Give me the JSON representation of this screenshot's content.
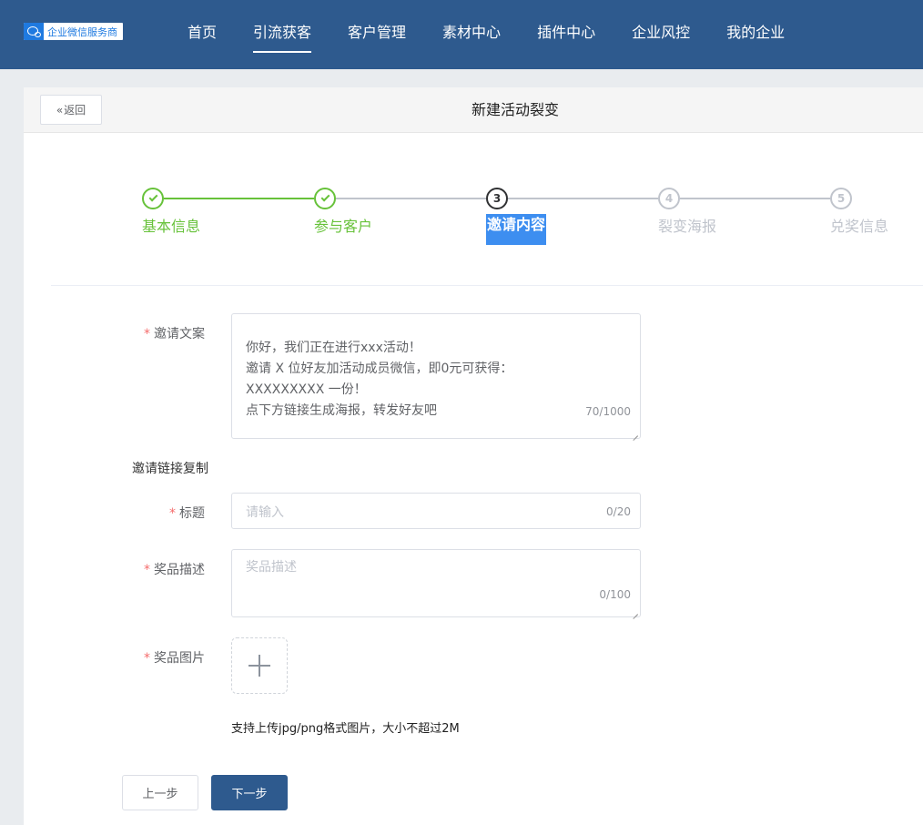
{
  "header": {
    "logo_text": "企业微信服务商",
    "nav": [
      {
        "label": "首页",
        "active": false
      },
      {
        "label": "引流获客",
        "active": true
      },
      {
        "label": "客户管理",
        "active": false
      },
      {
        "label": "素材中心",
        "active": false
      },
      {
        "label": "插件中心",
        "active": false
      },
      {
        "label": "企业风控",
        "active": false
      },
      {
        "label": "我的企业",
        "active": false
      }
    ]
  },
  "page": {
    "back_label": "返回",
    "title": "新建活动裂变"
  },
  "steps": [
    {
      "number": "1",
      "label": "基本信息",
      "status": "done"
    },
    {
      "number": "2",
      "label": "参与客户",
      "status": "done"
    },
    {
      "number": "3",
      "label": "邀请内容",
      "status": "current"
    },
    {
      "number": "4",
      "label": "裂变海报",
      "status": "pending"
    },
    {
      "number": "5",
      "label": "兑奖信息",
      "status": "pending"
    }
  ],
  "form": {
    "invite_text": {
      "label": "邀请文案",
      "lines": [
        "你好，我们正在进行xxx活动！",
        "邀请 X 位好友加活动成员微信，即0元可获得：",
        "XXXXXXXXX 一份！",
        "点下方链接生成海报，转发好友吧"
      ],
      "counter": "70/1000"
    },
    "link_section_title": "邀请链接复制",
    "title_field": {
      "label": "标题",
      "placeholder": "请输入",
      "counter": "0/20"
    },
    "prize_desc": {
      "label": "奖品描述",
      "placeholder": "奖品描述",
      "counter": "0/100"
    },
    "prize_image": {
      "label": "奖品图片",
      "hint": "支持上传jpg/png格式图片，大小不超过2M"
    }
  },
  "actions": {
    "prev_label": "上一步",
    "next_label": "下一步"
  }
}
